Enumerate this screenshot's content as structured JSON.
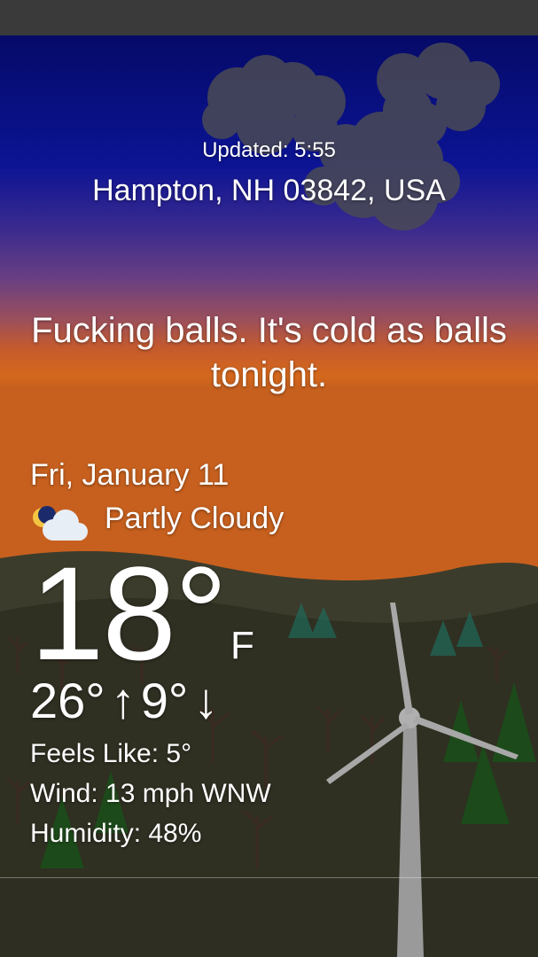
{
  "updated_label": "Updated:",
  "updated_time": "5:55",
  "location": "Hampton, NH 03842, USA",
  "quote": "Fucking balls. It's cold as balls tonight.",
  "date": "Fri, January 11",
  "condition": "Partly Cloudy",
  "condition_icon": "partly-cloudy-night-icon",
  "temperature": "18°",
  "unit": "F",
  "high": "26°",
  "high_arrow": "↑",
  "low": "9°",
  "low_arrow": "↓",
  "feels_like": "Feels Like: 5°",
  "wind": "Wind: 13 mph WNW",
  "humidity": "Humidity: 48%",
  "colors": {
    "sky_top": "#0a0f6e",
    "sky_mid": "#3a2a8c",
    "sunset": "#d0601e",
    "ground": "#2b2b1c"
  }
}
